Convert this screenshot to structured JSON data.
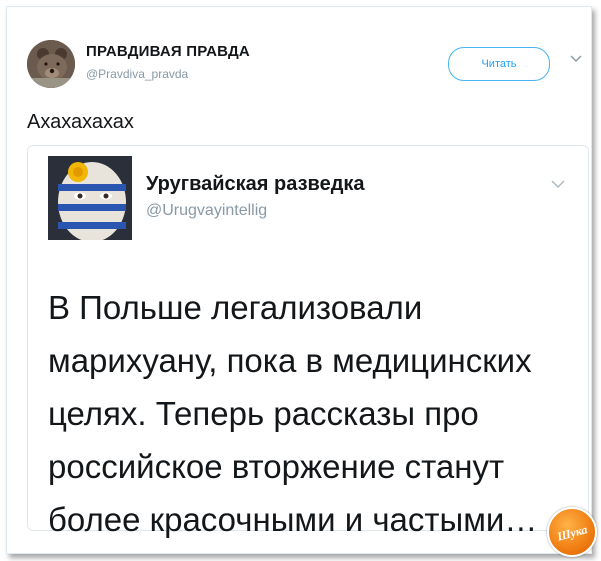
{
  "header": {
    "author_name": "ПРАВДИВАЯ ПРАВДА",
    "author_handle": "@Pravdiva_pravda",
    "follow_label": "Читать",
    "caret_icon": "chevron-down-icon"
  },
  "tweet": {
    "text": "Ахахахахах"
  },
  "quoted_tweet": {
    "author_name": "Уругвайская разведка",
    "author_handle": "@Urugvayintellig",
    "text_lines": [
      "В Польше легализовали",
      "марихуану, пока в медицинских",
      "целях. Теперь рассказы про",
      "российское вторжение станут",
      "более красочными и частыми…"
    ]
  },
  "watermark": {
    "text": "Шука"
  },
  "colors": {
    "accent": "#1da1f2",
    "muted": "#8899a6",
    "text": "#14171a",
    "border": "#e1e8ed",
    "watermark": "#f07d12"
  }
}
